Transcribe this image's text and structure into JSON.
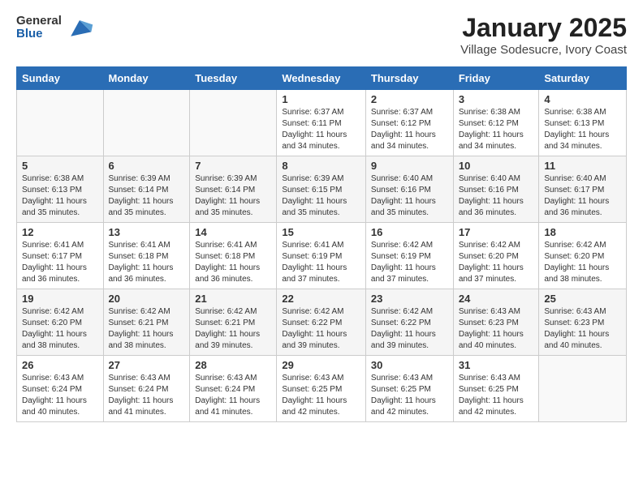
{
  "header": {
    "logo_general": "General",
    "logo_blue": "Blue",
    "title": "January 2025",
    "location": "Village Sodesucre, Ivory Coast"
  },
  "days_of_week": [
    "Sunday",
    "Monday",
    "Tuesday",
    "Wednesday",
    "Thursday",
    "Friday",
    "Saturday"
  ],
  "weeks": [
    [
      {
        "day": "",
        "sunrise": "",
        "sunset": "",
        "daylight": ""
      },
      {
        "day": "",
        "sunrise": "",
        "sunset": "",
        "daylight": ""
      },
      {
        "day": "",
        "sunrise": "",
        "sunset": "",
        "daylight": ""
      },
      {
        "day": "1",
        "sunrise": "Sunrise: 6:37 AM",
        "sunset": "Sunset: 6:11 PM",
        "daylight": "Daylight: 11 hours and 34 minutes."
      },
      {
        "day": "2",
        "sunrise": "Sunrise: 6:37 AM",
        "sunset": "Sunset: 6:12 PM",
        "daylight": "Daylight: 11 hours and 34 minutes."
      },
      {
        "day": "3",
        "sunrise": "Sunrise: 6:38 AM",
        "sunset": "Sunset: 6:12 PM",
        "daylight": "Daylight: 11 hours and 34 minutes."
      },
      {
        "day": "4",
        "sunrise": "Sunrise: 6:38 AM",
        "sunset": "Sunset: 6:13 PM",
        "daylight": "Daylight: 11 hours and 34 minutes."
      }
    ],
    [
      {
        "day": "5",
        "sunrise": "Sunrise: 6:38 AM",
        "sunset": "Sunset: 6:13 PM",
        "daylight": "Daylight: 11 hours and 35 minutes."
      },
      {
        "day": "6",
        "sunrise": "Sunrise: 6:39 AM",
        "sunset": "Sunset: 6:14 PM",
        "daylight": "Daylight: 11 hours and 35 minutes."
      },
      {
        "day": "7",
        "sunrise": "Sunrise: 6:39 AM",
        "sunset": "Sunset: 6:14 PM",
        "daylight": "Daylight: 11 hours and 35 minutes."
      },
      {
        "day": "8",
        "sunrise": "Sunrise: 6:39 AM",
        "sunset": "Sunset: 6:15 PM",
        "daylight": "Daylight: 11 hours and 35 minutes."
      },
      {
        "day": "9",
        "sunrise": "Sunrise: 6:40 AM",
        "sunset": "Sunset: 6:16 PM",
        "daylight": "Daylight: 11 hours and 35 minutes."
      },
      {
        "day": "10",
        "sunrise": "Sunrise: 6:40 AM",
        "sunset": "Sunset: 6:16 PM",
        "daylight": "Daylight: 11 hours and 36 minutes."
      },
      {
        "day": "11",
        "sunrise": "Sunrise: 6:40 AM",
        "sunset": "Sunset: 6:17 PM",
        "daylight": "Daylight: 11 hours and 36 minutes."
      }
    ],
    [
      {
        "day": "12",
        "sunrise": "Sunrise: 6:41 AM",
        "sunset": "Sunset: 6:17 PM",
        "daylight": "Daylight: 11 hours and 36 minutes."
      },
      {
        "day": "13",
        "sunrise": "Sunrise: 6:41 AM",
        "sunset": "Sunset: 6:18 PM",
        "daylight": "Daylight: 11 hours and 36 minutes."
      },
      {
        "day": "14",
        "sunrise": "Sunrise: 6:41 AM",
        "sunset": "Sunset: 6:18 PM",
        "daylight": "Daylight: 11 hours and 36 minutes."
      },
      {
        "day": "15",
        "sunrise": "Sunrise: 6:41 AM",
        "sunset": "Sunset: 6:19 PM",
        "daylight": "Daylight: 11 hours and 37 minutes."
      },
      {
        "day": "16",
        "sunrise": "Sunrise: 6:42 AM",
        "sunset": "Sunset: 6:19 PM",
        "daylight": "Daylight: 11 hours and 37 minutes."
      },
      {
        "day": "17",
        "sunrise": "Sunrise: 6:42 AM",
        "sunset": "Sunset: 6:20 PM",
        "daylight": "Daylight: 11 hours and 37 minutes."
      },
      {
        "day": "18",
        "sunrise": "Sunrise: 6:42 AM",
        "sunset": "Sunset: 6:20 PM",
        "daylight": "Daylight: 11 hours and 38 minutes."
      }
    ],
    [
      {
        "day": "19",
        "sunrise": "Sunrise: 6:42 AM",
        "sunset": "Sunset: 6:20 PM",
        "daylight": "Daylight: 11 hours and 38 minutes."
      },
      {
        "day": "20",
        "sunrise": "Sunrise: 6:42 AM",
        "sunset": "Sunset: 6:21 PM",
        "daylight": "Daylight: 11 hours and 38 minutes."
      },
      {
        "day": "21",
        "sunrise": "Sunrise: 6:42 AM",
        "sunset": "Sunset: 6:21 PM",
        "daylight": "Daylight: 11 hours and 39 minutes."
      },
      {
        "day": "22",
        "sunrise": "Sunrise: 6:42 AM",
        "sunset": "Sunset: 6:22 PM",
        "daylight": "Daylight: 11 hours and 39 minutes."
      },
      {
        "day": "23",
        "sunrise": "Sunrise: 6:42 AM",
        "sunset": "Sunset: 6:22 PM",
        "daylight": "Daylight: 11 hours and 39 minutes."
      },
      {
        "day": "24",
        "sunrise": "Sunrise: 6:43 AM",
        "sunset": "Sunset: 6:23 PM",
        "daylight": "Daylight: 11 hours and 40 minutes."
      },
      {
        "day": "25",
        "sunrise": "Sunrise: 6:43 AM",
        "sunset": "Sunset: 6:23 PM",
        "daylight": "Daylight: 11 hours and 40 minutes."
      }
    ],
    [
      {
        "day": "26",
        "sunrise": "Sunrise: 6:43 AM",
        "sunset": "Sunset: 6:24 PM",
        "daylight": "Daylight: 11 hours and 40 minutes."
      },
      {
        "day": "27",
        "sunrise": "Sunrise: 6:43 AM",
        "sunset": "Sunset: 6:24 PM",
        "daylight": "Daylight: 11 hours and 41 minutes."
      },
      {
        "day": "28",
        "sunrise": "Sunrise: 6:43 AM",
        "sunset": "Sunset: 6:24 PM",
        "daylight": "Daylight: 11 hours and 41 minutes."
      },
      {
        "day": "29",
        "sunrise": "Sunrise: 6:43 AM",
        "sunset": "Sunset: 6:25 PM",
        "daylight": "Daylight: 11 hours and 42 minutes."
      },
      {
        "day": "30",
        "sunrise": "Sunrise: 6:43 AM",
        "sunset": "Sunset: 6:25 PM",
        "daylight": "Daylight: 11 hours and 42 minutes."
      },
      {
        "day": "31",
        "sunrise": "Sunrise: 6:43 AM",
        "sunset": "Sunset: 6:25 PM",
        "daylight": "Daylight: 11 hours and 42 minutes."
      },
      {
        "day": "",
        "sunrise": "",
        "sunset": "",
        "daylight": ""
      }
    ]
  ]
}
